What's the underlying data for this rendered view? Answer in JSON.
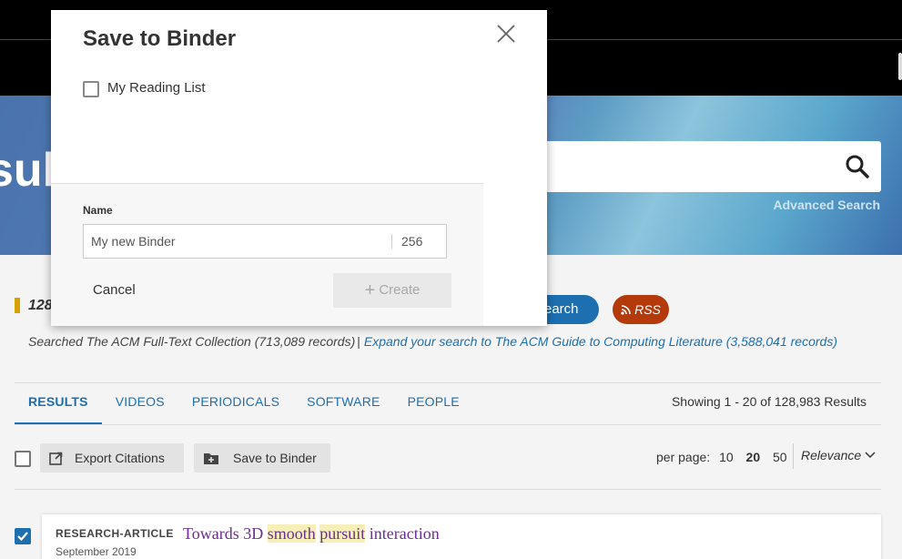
{
  "hero": {
    "title_fragment": "sul",
    "advanced_search": "Advanced Search"
  },
  "results_bar": {
    "count_fragment": "128",
    "save_search_fragment": "earch",
    "rss": "RSS",
    "searched_text": "Searched The ACM Full-Text Collection (713,089 records)",
    "separator": "|",
    "expand_link": "Expand your search to The ACM Guide to Computing Literature (3,588,041 records)"
  },
  "tabs": [
    {
      "label": "RESULTS",
      "active": true
    },
    {
      "label": "VIDEOS"
    },
    {
      "label": "PERIODICALS"
    },
    {
      "label": "SOFTWARE"
    },
    {
      "label": "PEOPLE"
    }
  ],
  "showing": "Showing 1 - 20  of 128,983 Results",
  "toolbar": {
    "export_citations": "Export Citations",
    "save_to_binder": "Save to Binder",
    "per_page_label": "per page:",
    "per_page_options": [
      "10",
      "20",
      "50"
    ],
    "per_page_selected": "20",
    "sort": "Relevance"
  },
  "result": {
    "type": "RESEARCH-ARTICLE",
    "date": "September 2019",
    "title_parts": [
      "Towards 3D ",
      "smooth",
      " ",
      "pursuit",
      " interaction"
    ]
  },
  "modal": {
    "title": "Save to Binder",
    "reading_list": "My Reading List",
    "name_label": "Name",
    "name_value": "My new Binder",
    "char_count": "256",
    "cancel": "Cancel",
    "create": "Create"
  },
  "colors": {
    "accent": "#1d6fb0",
    "rss": "#b4390b",
    "title_link": "#6b2f8f",
    "highlight": "#f6f0b8",
    "marker": "#d4a300"
  }
}
